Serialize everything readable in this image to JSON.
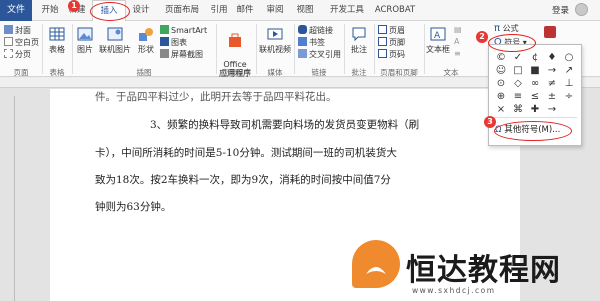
{
  "tabs": {
    "file": "文件",
    "start": "开始",
    "new": "新建",
    "insert": "插入",
    "design": "设计",
    "layout": "页面布局",
    "references": "引用",
    "mailings": "邮件",
    "review": "审阅",
    "view": "视图",
    "developer": "开发工具",
    "acrobat": "ACROBAT",
    "login": "登录"
  },
  "ribbon": {
    "cover": "封面",
    "blank_page": "空白页",
    "page_break": "分页",
    "table": "表格",
    "picture": "图片",
    "online_picture": "联机图片",
    "shapes": "形状",
    "smartart": "SmartArt",
    "chart": "图表",
    "screenshot": "屏幕截图",
    "office_apps": "Office\n应用程序",
    "online_video": "联机视频",
    "hyperlink": "超链接",
    "bookmark": "书签",
    "cross_ref": "交叉引用",
    "comment": "批注",
    "header": "页眉",
    "footer": "页脚",
    "page_number": "页码",
    "textbox": "文本框",
    "equation": "公式",
    "symbol": "符号"
  },
  "groups": {
    "pages": "页面",
    "tables": "表格",
    "illustrations": "插图",
    "apps": "应用程序",
    "media": "媒体",
    "links": "链接",
    "comments": "批注",
    "header_footer": "页眉和页脚",
    "text": "文本"
  },
  "document": {
    "line0": "件。于品四平料过少，此明开去等于品四平料花出。",
    "line1": "3、频繁的换料导致司机需要向料场的发货员变更物料（刷",
    "line2": "卡），中间所消耗的时间是5-10分钟。测试期间一班的司机装货大",
    "line3": "致为18次。按2车换料一次，即为9次，消耗的时间按中间值7分",
    "line4": "钟则为63分钟。"
  },
  "symbol_menu": {
    "symbols": [
      "©",
      "✓",
      "¢",
      "♦",
      "○",
      "☺",
      "□",
      "■",
      "→",
      "↗",
      "⊙",
      "◇",
      "∞",
      "≠",
      "⊥",
      "⊕",
      "≡",
      "≤",
      "±",
      "÷",
      "×",
      "⌘",
      "✚",
      "→"
    ],
    "more": "其他符号(M)..."
  },
  "badges": [
    "1",
    "2",
    "3"
  ],
  "watermark": {
    "brand": "恒达教程网",
    "url": "www.sxhdcj.com"
  }
}
